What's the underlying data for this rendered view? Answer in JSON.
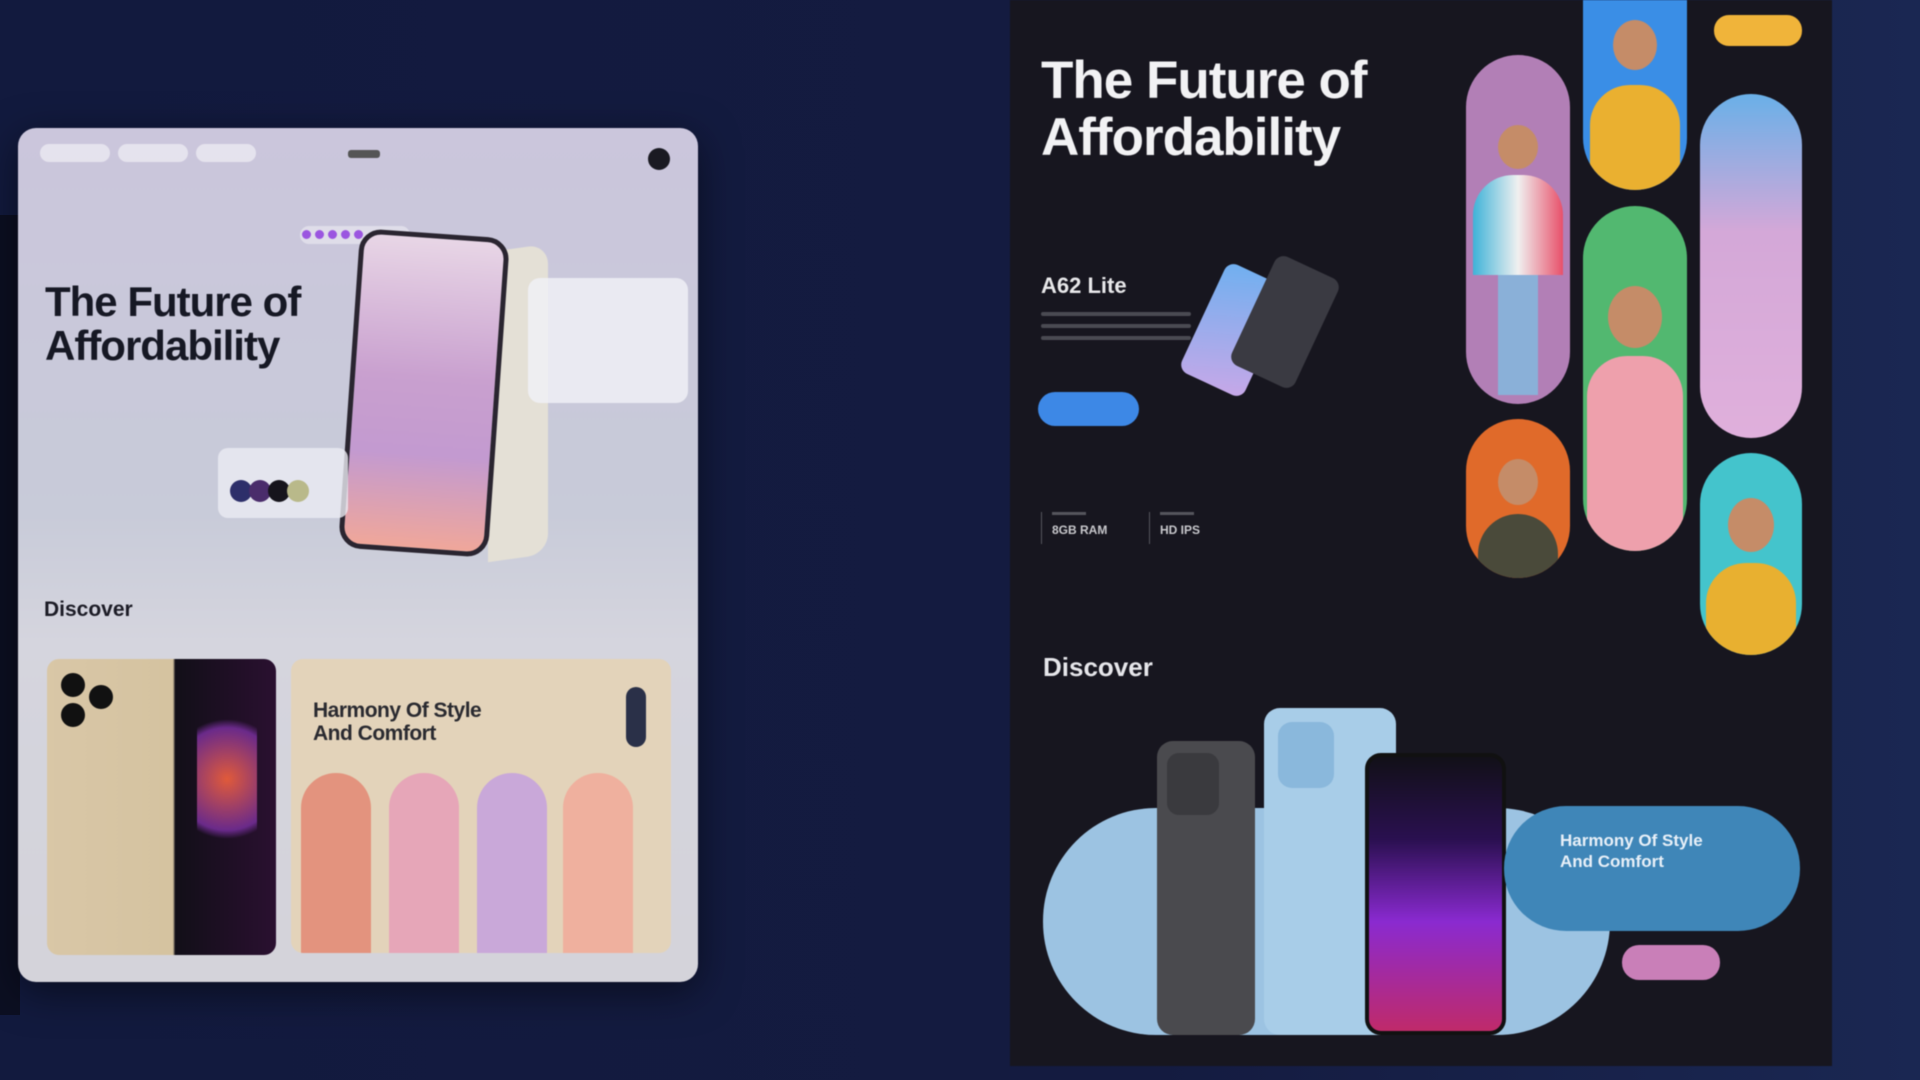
{
  "left_preview": {
    "title": "The Future of Affordability",
    "section": "Discover",
    "card_title": "Harmony Of Style And Comfort",
    "swatches": [
      "#2d2f6a",
      "#4a2c6b",
      "#16141c",
      "#b9b98a"
    ]
  },
  "right_preview": {
    "title": "The Future of Affordability",
    "model": "A62 Lite",
    "stats": [
      {
        "value": "8GB RAM"
      },
      {
        "value": "HD IPS"
      }
    ],
    "section": "Discover",
    "card_title": "Harmony Of Style And Comfort",
    "colors": {
      "accent_blue": "#3d88e6",
      "accent_yellow": "#f0b43a",
      "accent_pink": "#c97fb8",
      "card_blue": "#3f86b8"
    }
  }
}
